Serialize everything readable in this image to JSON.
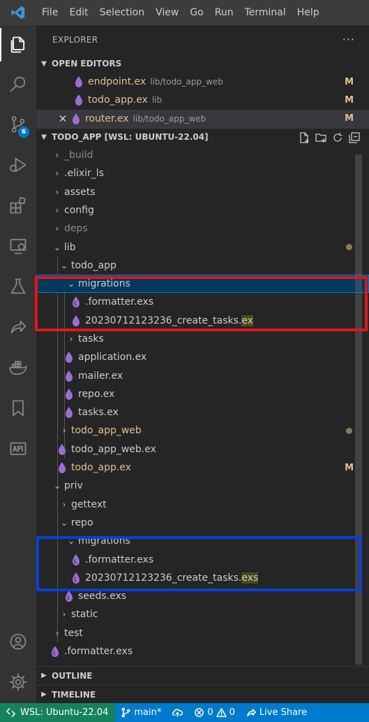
{
  "menu": [
    "File",
    "Edit",
    "Selection",
    "View",
    "Go",
    "Run",
    "Terminal",
    "Help"
  ],
  "activity": {
    "scm_badge": "6"
  },
  "explorer": {
    "title": "EXPLORER",
    "more": "···"
  },
  "open_editors": {
    "title": "OPEN EDITORS",
    "items": [
      {
        "name": "endpoint.ex",
        "desc": "lib/todo_app_web",
        "status": "M"
      },
      {
        "name": "todo_app.ex",
        "desc": "lib",
        "status": "M"
      },
      {
        "name": "router.ex",
        "desc": "lib/todo_app_web",
        "status": "M"
      }
    ]
  },
  "workspace": {
    "title": "TODO_APP [WSL: UBUNTU-22.04]",
    "tree": [
      {
        "label": "_build"
      },
      {
        "label": ".elixir_ls"
      },
      {
        "label": "assets"
      },
      {
        "label": "config"
      },
      {
        "label": "deps"
      },
      {
        "label": "lib"
      },
      {
        "label": "todo_app"
      },
      {
        "label": "migrations"
      },
      {
        "label": ".formatter.exs"
      },
      {
        "label_base": "20230712123236_create_tasks.",
        "label_ext": "ex"
      },
      {
        "label": "tasks"
      },
      {
        "label": "application.ex"
      },
      {
        "label": "mailer.ex"
      },
      {
        "label": "repo.ex"
      },
      {
        "label": "tasks.ex"
      },
      {
        "label": "todo_app_web"
      },
      {
        "label": "todo_app_web.ex"
      },
      {
        "label": "todo_app.ex",
        "status": "M"
      },
      {
        "label": "priv"
      },
      {
        "label": "gettext"
      },
      {
        "label": "repo"
      },
      {
        "label": "migrations"
      },
      {
        "label": ".formatter.exs"
      },
      {
        "label_base": "20230712123236_create_tasks.",
        "label_ext": "exs"
      },
      {
        "label": "seeds.exs"
      },
      {
        "label": "static"
      },
      {
        "label": "test"
      },
      {
        "label": ".formatter.exs"
      }
    ]
  },
  "outline": {
    "title": "OUTLINE"
  },
  "timeline": {
    "title": "TIMELINE"
  },
  "statusbar": {
    "remote": "WSL: Ubuntu-22.04",
    "branch": "main*",
    "errors": "0",
    "warnings": "0",
    "live_share": "Live Share"
  },
  "colors": {
    "elixir_icon": "#9b6fd1",
    "modified": "#e2c08d",
    "highlight_red": "#e0161d",
    "highlight_blue": "#0a3fd7",
    "statusbar": "#007acc",
    "remote": "#16825d"
  }
}
